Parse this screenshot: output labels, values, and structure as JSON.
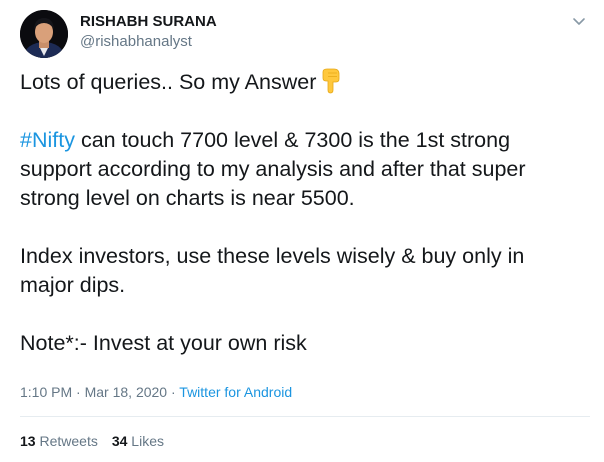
{
  "author": {
    "display_name": "RISHABH SURANA",
    "handle": "@rishabhanalyst",
    "avatar_icon": "profile-photo"
  },
  "menu": {
    "icon": "chevron-down-icon"
  },
  "tweet": {
    "line1_text": "Lots of queries.. So my Answer",
    "line1_emoji": "backhand-index-pointing-down-emoji",
    "hashtag": "#Nifty",
    "line2_rest": " can touch 7700 level & 7300 is the 1st strong",
    "line3": "support according to my analysis and after that super",
    "line4": "strong level on charts is near 5500.",
    "line5": "Index investors, use these levels wisely & buy only in",
    "line6": "major dips.",
    "line7": "Note*:- Invest at your own risk"
  },
  "meta": {
    "time": "1:10 PM",
    "sep1": " · ",
    "date": "Mar 18, 2020",
    "sep2": " · ",
    "source": "Twitter for Android"
  },
  "stats": {
    "retweets_count": "13",
    "retweets_label": "Retweets",
    "likes_count": "34",
    "likes_label": "Likes"
  },
  "colors": {
    "link": "#1b95e0",
    "text": "#14171a",
    "secondary": "#657786",
    "divider": "#e6ecf0"
  }
}
